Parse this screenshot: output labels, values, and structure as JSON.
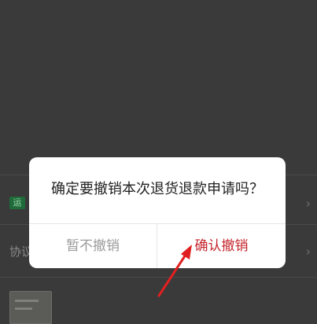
{
  "background": {
    "badge_text": "运",
    "row_label": "协议",
    "chevron": "›"
  },
  "dialog": {
    "message": "确定要撤销本次退货退款申请吗？",
    "cancel_label": "暂不撤销",
    "confirm_label": "确认撤销"
  },
  "annotation": {
    "arrow_color": "#e02020"
  },
  "colors": {
    "overlay": "#3a3a3a",
    "confirm": "#c4242b",
    "cancel": "#9a9a9a",
    "message": "#222222"
  }
}
